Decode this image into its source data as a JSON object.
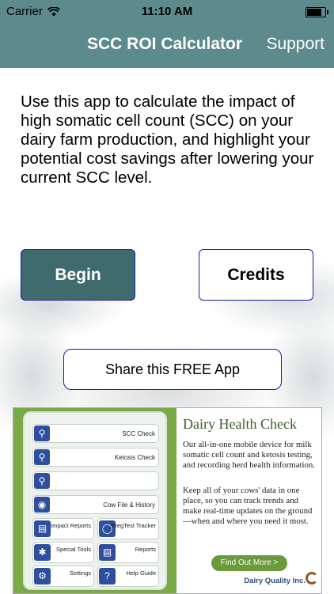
{
  "status_bar": {
    "carrier": "Carrier",
    "time": "11:10 AM",
    "battery_level": 0.95,
    "icons": [
      "wifi-icon",
      "battery-icon"
    ]
  },
  "nav": {
    "title": "SCC ROI Calculator",
    "support_label": "Support"
  },
  "intro_text": "Use this app to calculate the impact of high somatic cell count (SCC) on your dairy farm production, and highlight your potential cost savings after lowering your current SCC level.",
  "buttons": {
    "begin": "Begin",
    "credits": "Credits",
    "share": "Share this FREE App"
  },
  "ad": {
    "title": "Dairy Health Check",
    "paragraph1": "Our all-in-one mobile device for milk somatic cell count and ketosis testing, and recording herd health information.",
    "paragraph2": "Keep all of your cows' data in one place, so you can track trends and make real-time updates on the ground—when and where you need it most.",
    "cta": "Find Out More >",
    "brand": "Dairy Quality Inc.",
    "device_menu": {
      "scc_check": "SCC Check",
      "ketosis_check": "Ketosis Check",
      "cow_file": "Cow File & History",
      "impact_reports": "Impact Reports",
      "pregtest_tracker": "PregTest Tracker",
      "special_tools": "Special Tools",
      "reports": "Reports",
      "settings": "Settings",
      "help_guide": "Help Guide"
    }
  },
  "colors": {
    "nav_bg": "#5d8a8c",
    "begin_bg": "#3f6b6e",
    "button_border": "#1a1aa6",
    "ad_green": "#7aaa45"
  }
}
